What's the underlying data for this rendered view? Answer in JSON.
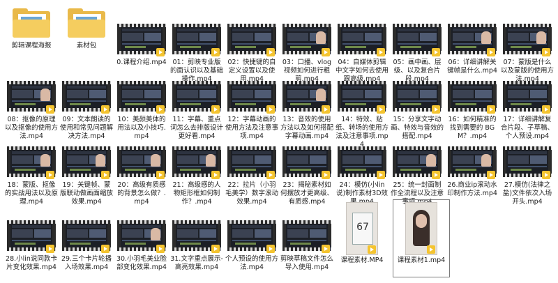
{
  "folders": [
    {
      "label": "剪辑课程海报"
    },
    {
      "label": "素材包"
    }
  ],
  "videos": [
    {
      "label": "0.课程介绍.mp4"
    },
    {
      "label": "01：剪映专业版的面认识以及基础操作.mp4"
    },
    {
      "label": "02：快捷键的自定义设置以及使用.mp4"
    },
    {
      "label": "03：口播、vlog视频如何进行粗剪.mp4"
    },
    {
      "label": "04：自媒体剪辑中文字如何去使用跟高级.mp4"
    },
    {
      "label": "05：画中画、层级、以及复合片段.mp4"
    },
    {
      "label": "06：详细讲解关键帧是什么.mp4"
    },
    {
      "label": "07：蒙版是什么以及蒙版的使用方法.mp4"
    },
    {
      "label": "08：抠像的原理以及抠像的使用方法.mp4"
    },
    {
      "label": "09：文本朗读的使用和常见问题解决方法.mp4"
    },
    {
      "label": "10：美颜美体的用法以及小技巧.mp4"
    },
    {
      "label": "11：字幕、重点词怎么去排版设计更好看.mp4"
    },
    {
      "label": "12：字幕动画的使用方法及注意事项.mp4"
    },
    {
      "label": "13：音效的使用方法以及如何搭配字幕动画.mp4"
    },
    {
      "label": "14：特效、贴纸、转场的使用方法及注意事项.mp4"
    },
    {
      "label": "15：分享文字动画、特效与音效的搭配.mp4"
    },
    {
      "label": "16：如何精准的找到需要的 BGM？.mp4"
    },
    {
      "label": "17：详细讲解复合片段、子草稿、个人预设.mp4"
    },
    {
      "label": "18：蒙版、抠像的实战用法以及原理.mp4"
    },
    {
      "label": "19：关键帧、蒙版联动做画面缩放效果.mp4"
    },
    {
      "label": "20：高级有质感的背景怎么做？.mp4"
    },
    {
      "label": "21：高级感的人物矩形框如何制作？.mp4"
    },
    {
      "label": "22：拉片（小羽毛美学）数字滚动效果.mp4"
    },
    {
      "label": "23：揭秘素材如何摆放才更高级、有质感.mp4"
    },
    {
      "label": "24：模仿(小lin说)制作素材3D效果.mp4"
    },
    {
      "label": "25：统一封面制作全流程以及注意事项.mp4"
    },
    {
      "label": "26.商业ip滚动水印制作方法.mp4"
    },
    {
      "label": "27.模仿(法律之盐)文件依次入场开头.mp4"
    },
    {
      "label": "28.小lin说同款卡片变化效果.mp4"
    },
    {
      "label": "29.三个卡片轮播入场效果.mp4"
    },
    {
      "label": "30.小羽毛美业脸部变化效果.mp4"
    },
    {
      "label": "31.文字重点展示-高亮效果.mp4"
    },
    {
      "label": "个人预设的使用方法.mp4"
    },
    {
      "label": "剪映草稿文件怎么导入使用.mp4"
    }
  ],
  "materials": [
    {
      "label": "课程素材.MP4",
      "photo_text": "67"
    },
    {
      "label": "课程素材1.mp4"
    }
  ]
}
